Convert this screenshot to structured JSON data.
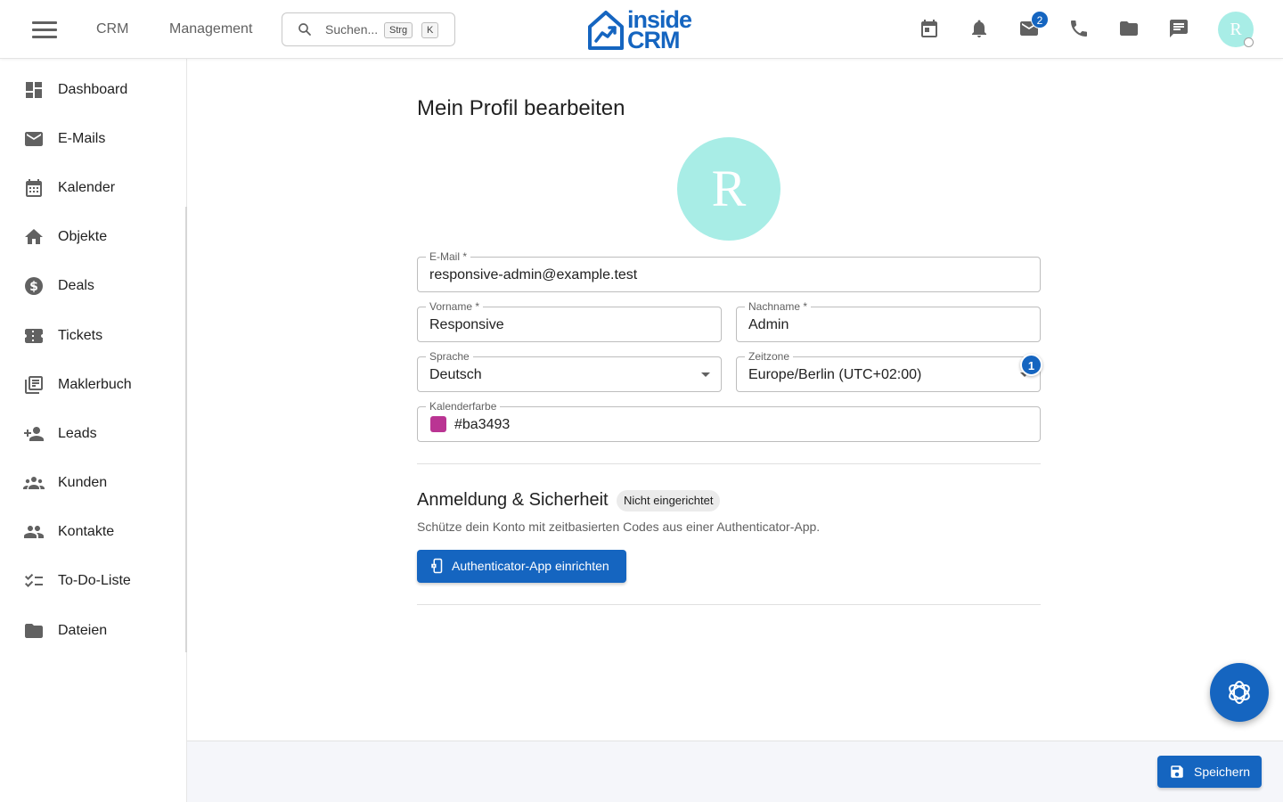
{
  "header": {
    "nav": [
      "CRM",
      "Management"
    ],
    "search_placeholder": "Suchen...",
    "shortcut_keys": [
      "Strg",
      "K"
    ],
    "logo_line1": "inside",
    "logo_line2": "CRM",
    "mail_badge": "2",
    "avatar_initial": "R",
    "icons": [
      "calendar-icon",
      "bell-icon",
      "mail-icon",
      "phone-icon",
      "folder-icon",
      "chat-icon"
    ]
  },
  "sidebar": {
    "items": [
      {
        "label": "Dashboard",
        "icon": "dashboard-icon"
      },
      {
        "label": "E-Mails",
        "icon": "mail-icon"
      },
      {
        "label": "Kalender",
        "icon": "calendar-icon"
      },
      {
        "label": "Objekte",
        "icon": "home-icon"
      },
      {
        "label": "Deals",
        "icon": "dollar-icon"
      },
      {
        "label": "Tickets",
        "icon": "ticket-icon"
      },
      {
        "label": "Maklerbuch",
        "icon": "library-icon"
      },
      {
        "label": "Leads",
        "icon": "person-add-icon"
      },
      {
        "label": "Kunden",
        "icon": "groups-icon"
      },
      {
        "label": "Kontakte",
        "icon": "people-icon"
      },
      {
        "label": "To-Do-Liste",
        "icon": "checklist-icon"
      },
      {
        "label": "Dateien",
        "icon": "folder-icon"
      }
    ]
  },
  "profile": {
    "title": "Mein Profil bearbeiten",
    "avatar_initial": "R",
    "email": {
      "label": "E-Mail *",
      "value": "responsive-admin@example.test"
    },
    "firstname": {
      "label": "Vorname *",
      "value": "Responsive"
    },
    "lastname": {
      "label": "Nachname *",
      "value": "Admin"
    },
    "language": {
      "label": "Sprache",
      "value": "Deutsch"
    },
    "timezone": {
      "label": "Zeitzone",
      "value": "Europe/Berlin (UTC+02:00)",
      "badge": "1"
    },
    "calendar_color": {
      "label": "Kalenderfarbe",
      "value": "#ba3493",
      "color": "#ba3493"
    }
  },
  "security": {
    "title": "Anmeldung & Sicherheit",
    "status_chip": "Nicht eingerichtet",
    "description": "Schütze dein Konto mit zeitbasierten Codes aus einer Authenticator-App.",
    "button_label": "Authenticator-App einrichten"
  },
  "footer": {
    "save_label": "Speichern"
  },
  "colors": {
    "primary": "#1565c0",
    "avatar": "#a8ede6"
  }
}
